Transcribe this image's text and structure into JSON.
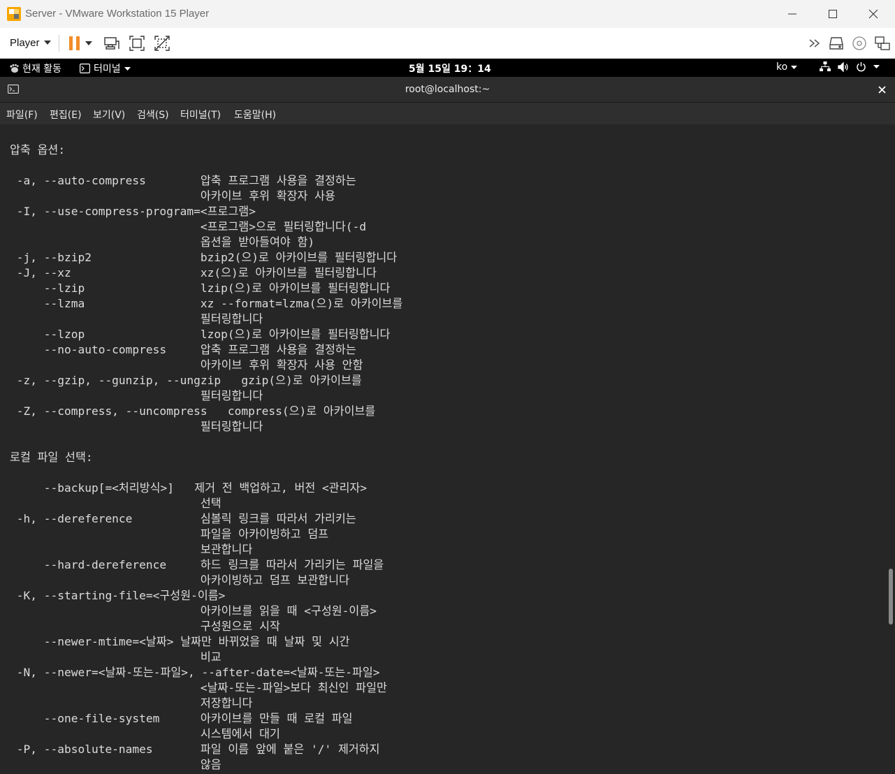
{
  "vmware": {
    "window_title": "Server - VMware Workstation 15 Player",
    "player_menu": "Player",
    "colors": {
      "pause_orange": "#f28c28",
      "titlebar_bg": "#f3f3f3"
    },
    "icons": {
      "logo": "vmware-logo-icon",
      "minimize": "minimize-icon",
      "maximize": "maximize-icon",
      "close": "close-icon",
      "pause": "pause-icon",
      "send_ctrl_alt_del": "send-keys-icon",
      "fit_guest": "fit-guest-icon",
      "unity": "unity-icon",
      "more": "double-chevron-icon",
      "hdd": "hard-disk-icon",
      "cd": "cd-icon",
      "network": "network-adapter-icon"
    }
  },
  "gnome": {
    "activities": "현재 활동",
    "terminal_app": "터미널",
    "clock": "5월 15일  19：14",
    "keyboard_layout": "ko"
  },
  "terminal": {
    "title": "root@localhost:~",
    "menu": [
      "파일(F)",
      "편집(E)",
      "보기(V)",
      "검색(S)",
      "터미널(T)",
      "도움말(H)"
    ],
    "lines": [
      "압축 옵션:",
      "",
      " -a, --auto-compress        압축 프로그램 사용을 결정하는",
      "                            아카이브 후위 확장자 사용",
      " -I, --use-compress-program=<프로그램>",
      "                            <프로그램>으로 필터링합니다(-d",
      "                            옵션을 받아들여야 함)",
      " -j, --bzip2                bzip2(으)로 아카이브를 필터링합니다",
      " -J, --xz                   xz(으)로 아카이브를 필터링합니다",
      "     --lzip                 lzip(으)로 아카이브를 필터링합니다",
      "     --lzma                 xz --format=lzma(으)로 아카이브를",
      "                            필터링합니다",
      "     --lzop                 lzop(으)로 아카이브를 필터링합니다",
      "     --no-auto-compress     압축 프로그램 사용을 결정하는",
      "                            아카이브 후위 확장자 사용 안함",
      " -z, --gzip, --gunzip, --ungzip   gzip(으)로 아카이브를",
      "                            필터링합니다",
      " -Z, --compress, --uncompress   compress(으)로 아카이브를",
      "                            필터링합니다",
      "",
      "로컬 파일 선택:",
      "",
      "     --backup[=<처리방식>]   제거 전 백업하고, 버전 <관리자>",
      "                            선택",
      " -h, --dereference          심볼릭 링크를 따라서 가리키는",
      "                            파일을 아카이빙하고 덤프",
      "                            보관합니다",
      "     --hard-dereference     하드 링크를 따라서 가리키는 파일을",
      "                            아카이빙하고 덤프 보관합니다",
      " -K, --starting-file=<구성원-이름>",
      "                            아카이브를 읽을 때 <구성원-이름>",
      "                            구성원으로 시작",
      "     --newer-mtime=<날짜> 날짜만 바뀌었을 때 날짜 및 시간",
      "                            비교",
      " -N, --newer=<날짜-또는-파일>, --after-date=<날짜-또는-파일>",
      "                            <날짜-또는-파일>보다 최신인 파일만",
      "                            저장합니다",
      "     --one-file-system      아카이브를 만들 때 로컬 파일",
      "                            시스템에서 대기",
      " -P, --absolute-names       파일 이름 앞에 붙은 '/' 제거하지",
      "                            않음"
    ]
  }
}
